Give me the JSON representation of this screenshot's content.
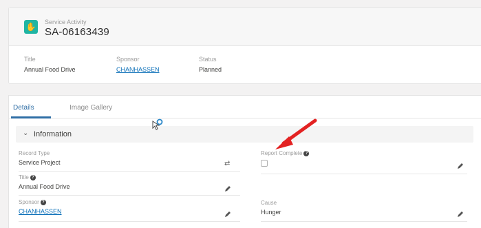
{
  "record": {
    "object_type": "Service Activity",
    "name": "SA-06163439",
    "icon": "handshake-icon"
  },
  "highlights": [
    {
      "label": "Title",
      "value": "Annual Food Drive",
      "link": false
    },
    {
      "label": "Sponsor",
      "value": "CHANHASSEN",
      "link": true
    },
    {
      "label": "Status",
      "value": "Planned",
      "link": false
    }
  ],
  "tabs": [
    {
      "label": "Details",
      "active": true
    },
    {
      "label": "Image Gallery",
      "active": false
    }
  ],
  "section": {
    "title": "Information"
  },
  "fields": {
    "record_type": {
      "label": "Record Type",
      "value": "Service Project"
    },
    "report_complete": {
      "label": "Report Complete",
      "checked": false
    },
    "title": {
      "label": "Title",
      "value": "Annual Food Drive"
    },
    "sponsor": {
      "label": "Sponsor",
      "value": "CHANHASSEN"
    },
    "cause": {
      "label": "Cause",
      "value": "Hunger"
    }
  },
  "colors": {
    "accent": "#2f6ea5",
    "link": "#0b6fb8",
    "object_icon": "#1fb5a3",
    "arrow": "#e32222"
  }
}
